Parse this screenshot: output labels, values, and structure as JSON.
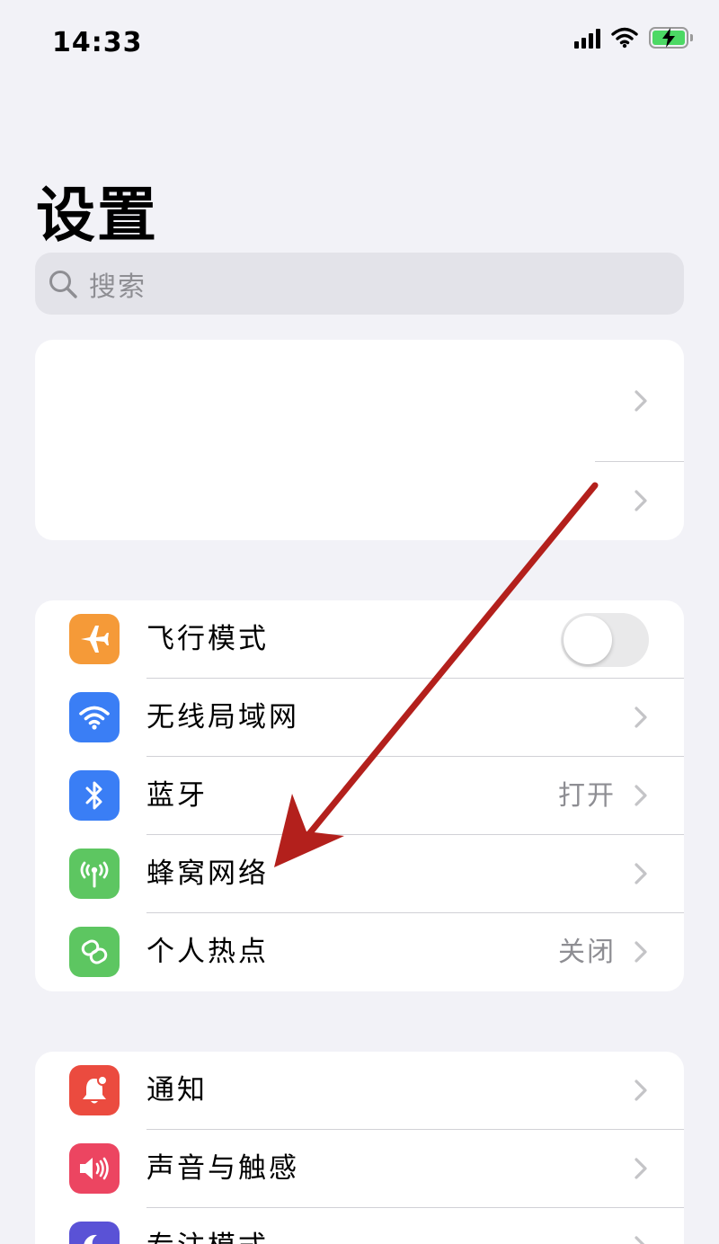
{
  "status": {
    "time": "14:33"
  },
  "page": {
    "title": "设置"
  },
  "search": {
    "placeholder": "搜索"
  },
  "network_group": {
    "items": [
      {
        "label": "飞行模式",
        "icon": "airplane-icon",
        "color": "#f59a38",
        "control": "toggle",
        "toggle_on": false
      },
      {
        "label": "无线局域网",
        "icon": "wifi-icon",
        "color": "#3a7ef5",
        "control": "chevron"
      },
      {
        "label": "蓝牙",
        "icon": "bluetooth-icon",
        "color": "#3a7ef5",
        "value": "打开",
        "control": "chevron"
      },
      {
        "label": "蜂窝网络",
        "icon": "cellular-icon",
        "color": "#5dc661",
        "control": "chevron"
      },
      {
        "label": "个人热点",
        "icon": "hotspot-icon",
        "color": "#5dc661",
        "value": "关闭",
        "control": "chevron"
      }
    ]
  },
  "notify_group": {
    "items": [
      {
        "label": "通知",
        "icon": "notification-bell-icon",
        "color": "#eb4b3f",
        "control": "chevron"
      },
      {
        "label": "声音与触感",
        "icon": "speaker-icon",
        "color": "#ec4561",
        "control": "chevron"
      },
      {
        "label": "专注模式",
        "icon": "moon-icon",
        "color": "#5a52d6",
        "control": "chevron"
      }
    ]
  },
  "annotation": {
    "arrow_color": "#b3201c",
    "points_to": "蜂窝网络"
  },
  "colors": {
    "background": "#f2f2f7",
    "battery_fill": "#4cd964",
    "secondary_text": "#8e8e93"
  }
}
